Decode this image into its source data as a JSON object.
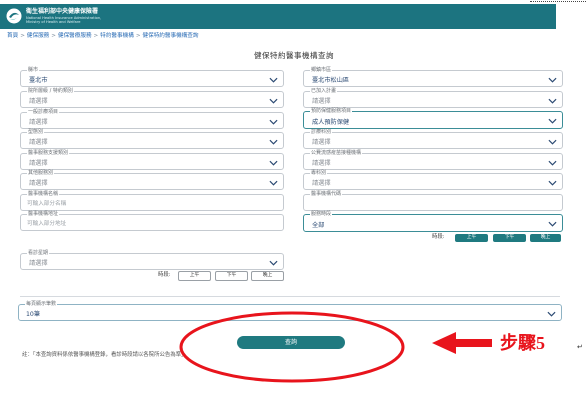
{
  "header": {
    "org_name": "衛生福利部中央健康保險署",
    "org_name_en_1": "National Health Insurance Administration,",
    "org_name_en_2": "Ministry of Health and Welfare",
    "logo_icon": "nhi-logo-icon"
  },
  "breadcrumb": {
    "separator": ">",
    "items": [
      "首頁",
      "健保服務",
      "健保醫療服務",
      "特約醫事機構",
      "健保特約醫事機構查詢"
    ]
  },
  "page_title": "健保特約醫事機構查詢",
  "fields": {
    "county": {
      "label": "縣市",
      "value": "臺北市"
    },
    "district": {
      "label": "鄉鎮市區",
      "value": "臺北市松山區"
    },
    "level_type": {
      "label": "院所層級 / 特約類別",
      "value": "請選擇"
    },
    "plan": {
      "label": "已加入計畫",
      "value": "請選擇"
    },
    "general_item": {
      "label": "一般診療項目",
      "value": "請選擇"
    },
    "preventive_item": {
      "label": "預防保健服務項目",
      "value": "成人預防保健"
    },
    "form_type": {
      "label": "型態別",
      "value": "請選擇"
    },
    "department": {
      "label": "診療科別",
      "value": "請選擇"
    },
    "support_type": {
      "label": "醫事服務支援類別",
      "value": "請選擇"
    },
    "flu_vaccine": {
      "label": "公費流感疫苗接種機構",
      "value": "請選擇"
    },
    "other_service": {
      "label": "其他服務別",
      "value": "請選擇"
    },
    "specialty": {
      "label": "專科別",
      "value": "請選擇"
    },
    "institution_name": {
      "label": "醫事機構名稱",
      "placeholder": "可輸入部分名稱"
    },
    "institution_code": {
      "label": "醫事機構代碼",
      "placeholder": ""
    },
    "institution_address": {
      "label": "醫事機構地址",
      "placeholder": "可輸入部分地址"
    },
    "service_period": {
      "label": "服務時段",
      "value": "全部"
    },
    "weekday": {
      "label": "看診星期",
      "value": "請選擇"
    }
  },
  "time_filter_1": {
    "label": "時段:",
    "options": [
      "上午",
      "下午",
      "晚上"
    ]
  },
  "time_filter_2": {
    "label": "時段:",
    "options": [
      "上午",
      "下午",
      "晚上"
    ]
  },
  "page_size": {
    "label": "每頁顯示筆數",
    "value": "10筆"
  },
  "query_button": "查詢",
  "note": "註：「本查詢資料係依醫事機構登錄，看診時段請以各院所公告為準」。",
  "annotation": {
    "step_label": "步驟5",
    "return_mark": "↵"
  },
  "colors": {
    "header": "#1c7480",
    "button": "#1f7a80",
    "link": "#2a6cb5",
    "value_text": "#2b4a73",
    "annotation_red": "#e8141c"
  }
}
